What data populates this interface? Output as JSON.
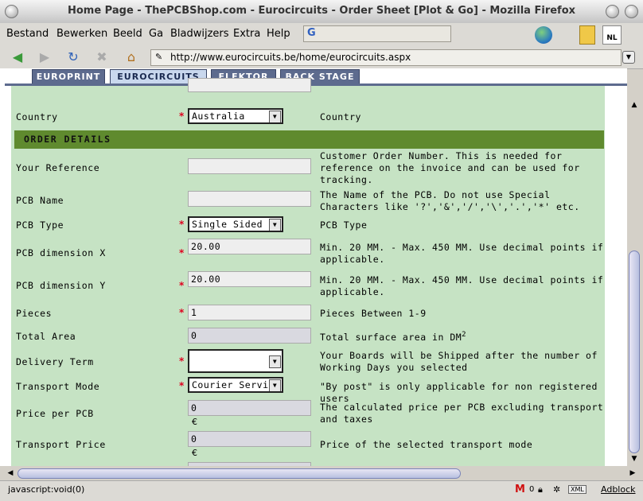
{
  "window": {
    "title": "Home Page - ThePCBShop.com - Eurocircuits - Order Sheet [Plot & Go] - Mozilla Firefox"
  },
  "menu": [
    "Bestand",
    "Bewerken",
    "Beeld",
    "Ga",
    "Bladwijzers",
    "Extra",
    "Help"
  ],
  "nav": {
    "url": "http://www.eurocircuits.be/home/eurocircuits.aspx"
  },
  "tabs": [
    "EUROPRINT",
    "EUROCIRCUITS",
    "ELEKTOR",
    "BACK STAGE"
  ],
  "form": {
    "country": {
      "label": "Country",
      "value": "Australia",
      "desc": "Country"
    },
    "section_title": "ORDER DETAILS",
    "your_reference": {
      "label": "Your Reference",
      "value": "",
      "desc": "Customer Order Number. This is needed for reference on the invoice and can be used for tracking."
    },
    "pcb_name": {
      "label": "PCB Name",
      "value": "",
      "desc": "The Name of the PCB. Do not use Special Characters like '?','&','/','\\','.','*' etc."
    },
    "pcb_type": {
      "label": "PCB Type",
      "value": "Single Sided",
      "desc": "PCB Type"
    },
    "dim_x": {
      "label": "PCB dimension X",
      "value": "20.00",
      "desc": "Min. 20 MM. - Max. 450 MM. Use decimal points if applicable."
    },
    "dim_y": {
      "label": "PCB dimension Y",
      "value": "20.00",
      "desc": "Min. 20 MM. - Max. 450 MM. Use decimal points if applicable."
    },
    "pieces": {
      "label": "Pieces",
      "value": "1",
      "desc": "Pieces Between 1-9"
    },
    "total_area": {
      "label": "Total Area",
      "value": "0",
      "desc": "Total surface area in DM",
      "sup": "2"
    },
    "delivery_term": {
      "label": "Delivery Term",
      "value": "",
      "desc": "Your Boards will be Shipped after the number of Working Days you selected"
    },
    "transport_mode": {
      "label": "Transport Mode",
      "value": "Courier Servic",
      "desc": "\"By post\" is only applicable for non registered users"
    },
    "price_per_pcb": {
      "label": "Price per PCB",
      "value": "0",
      "currency": "€",
      "desc": "The calculated price per PCB excluding transport and taxes"
    },
    "transport_price": {
      "label": "Transport Price",
      "value": "0",
      "currency": "€",
      "desc": "Price of the selected transport mode"
    },
    "required_mark": "*"
  },
  "status": {
    "text": "javascript:void(0)",
    "adblock": "Adblock"
  }
}
